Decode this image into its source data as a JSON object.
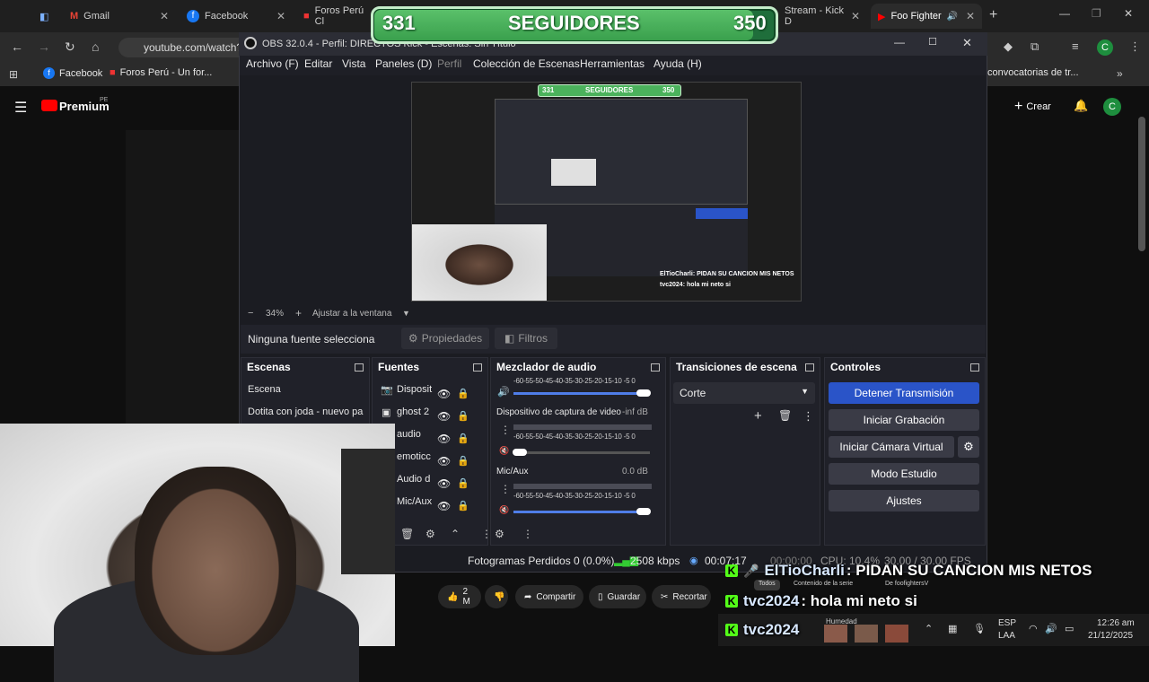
{
  "browser": {
    "tabs": [
      {
        "label": "Gmail"
      },
      {
        "label": "Facebook"
      },
      {
        "label": "Foros Perú Cl"
      },
      {
        "label": "Stream - Kick D"
      },
      {
        "label": "Foo Fighter"
      }
    ],
    "url": "youtube.com/watch?",
    "bookmarks": [
      {
        "label": "Facebook"
      },
      {
        "label": "Foros Perú - Un for..."
      },
      {
        "label": "convocatorias de tr..."
      }
    ],
    "avatar_letter": "C"
  },
  "youtube": {
    "logo": "Premium",
    "region": "PE",
    "create_label": "Crear",
    "avatar_letter": "C",
    "likes": "2 M",
    "share": "Compartir",
    "save": "Guardar",
    "clip": "Recortar",
    "chips": [
      "Todos",
      "Contenido de la serie",
      "De foofightersV"
    ]
  },
  "followers": {
    "current": "331",
    "label": "SEGUIDORES",
    "goal": "350",
    "progress_fraction": 0.946
  },
  "obs": {
    "title": "OBS 32.0.4 - Perfil: DIRECTOS Kick - Escenas: Sin Título",
    "menu": [
      "Archivo (F)",
      "Editar",
      "Vista",
      "Paneles (D)",
      "Perfil",
      "Colección de Escenas",
      "Herramientas",
      "Ayuda (H)"
    ],
    "zoom": "34%",
    "fit_label": "Ajustar a la ventana",
    "no_source": "Ninguna fuente selecciona",
    "properties": "Propiedades",
    "filters": "Filtros",
    "docks": {
      "scenes_title": "Escenas",
      "sources_title": "Fuentes",
      "mixer_title": "Mezclador de audio",
      "transitions_title": "Transiciones de escena",
      "controls_title": "Controles"
    },
    "scenes": [
      "Escena",
      "Dotita con joda - nuevo pa"
    ],
    "sources": [
      "Disposit",
      "ghost 2",
      "audio",
      "emoticc",
      "Audio d",
      "Mic/Aux"
    ],
    "mixer": {
      "scale": "-60-55-50-45-40-35-30-25-20-15-10 -5  0",
      "channels": [
        {
          "name": "Dispositivo de captura de video",
          "db": "-inf dB",
          "level_fraction": 0.0
        },
        {
          "name": "Mic/Aux",
          "db": "0.0 dB",
          "level_fraction": 0.9
        }
      ]
    },
    "transition": "Corte",
    "controls": [
      "Detener Transmisión",
      "Iniciar Grabación",
      "Iniciar Cámara Virtual",
      "Modo Estudio",
      "Ajustes"
    ],
    "status": {
      "dropped": "Fotogramas Perdidos 0 (0.0%)",
      "bitrate": "2508 kbps",
      "live_time": "00:07:17",
      "rec_time": "00:00:00",
      "cpu": "CPU: 10.4%",
      "fps": "30.00 / 30.00 FPS"
    },
    "preview_overlay": {
      "followers_current": "331",
      "followers_label": "SEGUIDORES",
      "followers_goal": "350",
      "chat1_user": "ElTioCharli",
      "chat1_msg": ": PIDAN SU CANCION MIS NETOS",
      "chat2_user": "tvc2024",
      "chat2_msg": ": hola mi neto si"
    }
  },
  "chat": [
    {
      "user": "ElTioCharli",
      "message": ": PIDAN SU CANCION MIS NETOS"
    },
    {
      "user": "tvc2024",
      "message": ": hola mi neto si"
    },
    {
      "user": "tvc2024",
      "message": ""
    }
  ],
  "taskbar": {
    "lang": "ESP",
    "layout": "LAA",
    "time": "12:26 am",
    "date": "21/12/2025",
    "weather": "Humedad"
  },
  "colors": {
    "accent_blue": "#2a54c8",
    "kick_green": "#53fc18",
    "follow_green": "#3aa04d"
  }
}
